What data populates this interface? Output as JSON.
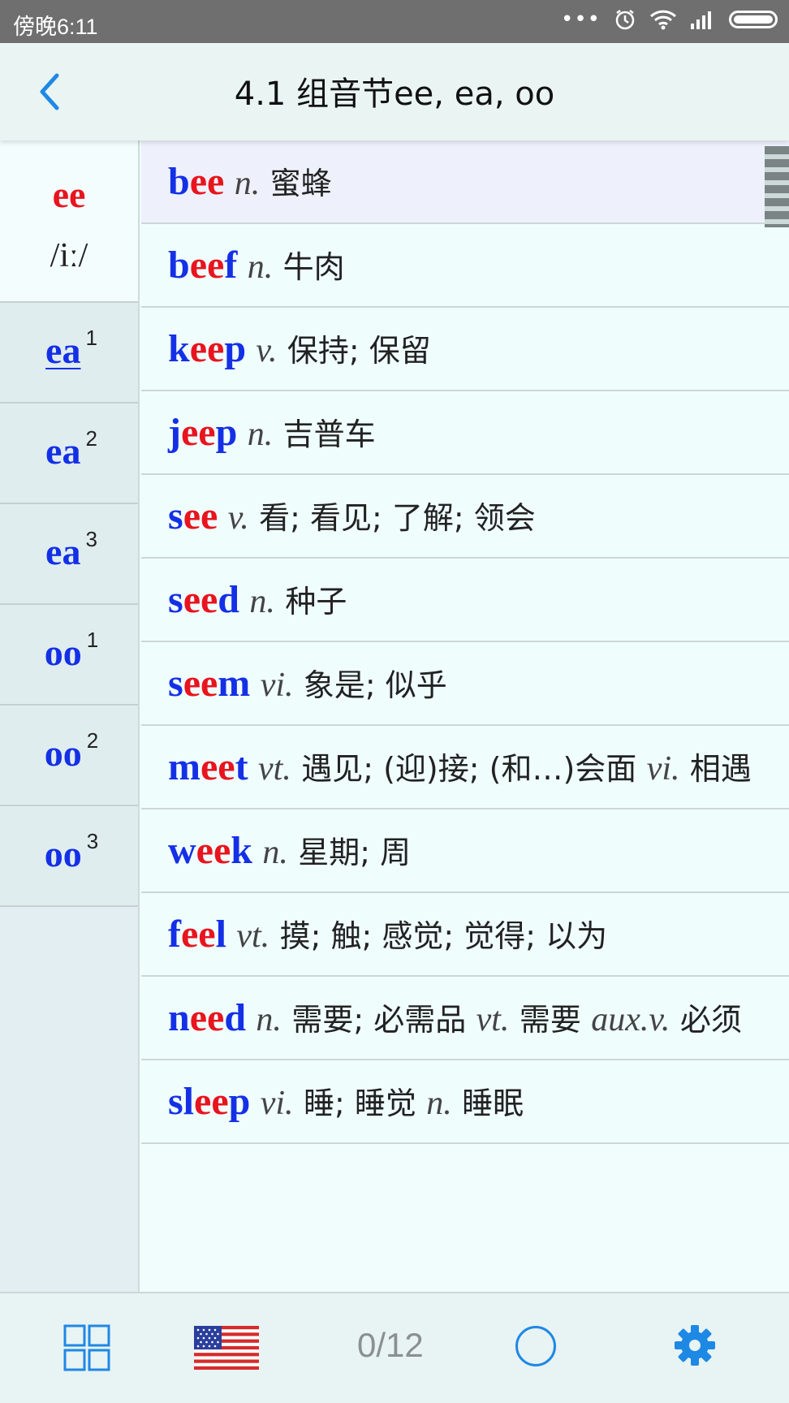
{
  "status_bar": {
    "time": "傍晚6:11",
    "dots": "•••"
  },
  "header": {
    "title": "4.1 组音节ee, ea, oo"
  },
  "sidebar": {
    "items": [
      {
        "pattern": "ee",
        "ipa": "/iː/",
        "sup": ""
      },
      {
        "pattern": "ea",
        "sup": "1"
      },
      {
        "pattern": "ea",
        "sup": "2"
      },
      {
        "pattern": "ea",
        "sup": "3"
      },
      {
        "pattern": "oo",
        "sup": "1"
      },
      {
        "pattern": "oo",
        "sup": "2"
      },
      {
        "pattern": "oo",
        "sup": "3"
      }
    ]
  },
  "words": [
    {
      "word": [
        "b",
        "ee"
      ],
      "pos": "n.",
      "def": "蜜蜂"
    },
    {
      "word": [
        "b",
        "ee",
        "f"
      ],
      "pos": "n.",
      "def": "牛肉"
    },
    {
      "word": [
        "k",
        "ee",
        "p"
      ],
      "pos": "v.",
      "def": "保持; 保留"
    },
    {
      "word": [
        "j",
        "ee",
        "p"
      ],
      "pos": "n.",
      "def": "吉普车"
    },
    {
      "word": [
        "s",
        "ee"
      ],
      "pos": "v.",
      "def": "看; 看见; 了解; 领会"
    },
    {
      "word": [
        "s",
        "ee",
        "d"
      ],
      "pos": "n.",
      "def": "种子"
    },
    {
      "word": [
        "s",
        "ee",
        "m"
      ],
      "pos": "vi.",
      "def": "象是; 似乎"
    },
    {
      "word": [
        "m",
        "ee",
        "t"
      ],
      "pos": "vt.",
      "def": "遇见; (迎)接; (和…)会面",
      "pos2": "vi.",
      "def2": "相遇"
    },
    {
      "word": [
        "w",
        "ee",
        "k"
      ],
      "pos": "n.",
      "def": "星期; 周"
    },
    {
      "word": [
        "f",
        "ee",
        "l"
      ],
      "pos": "vt.",
      "def": "摸; 触; 感觉; 觉得; 以为"
    },
    {
      "word": [
        "n",
        "ee",
        "d"
      ],
      "pos": "n.",
      "def": "需要; 必需品",
      "pos2": "vt.",
      "def2": "需要",
      "pos3": "aux.v.",
      "def3": "必须"
    },
    {
      "word": [
        "sl",
        "ee",
        "p"
      ],
      "pos": "vi.",
      "def": "睡; 睡觉",
      "pos2": "n.",
      "def2": "睡眠"
    }
  ],
  "bottom_bar": {
    "progress": "0/12"
  },
  "colors": {
    "word_blue": "#1430e6",
    "word_red": "#e8141e",
    "accent": "#1e88e5"
  }
}
